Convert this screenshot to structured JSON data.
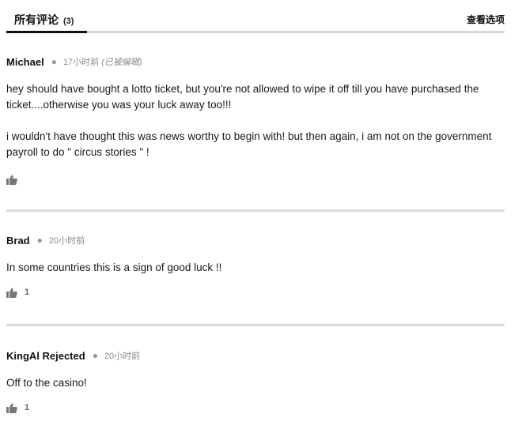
{
  "header": {
    "tab_title": "所有评论",
    "tab_count": "(3)",
    "view_options": "查看选项"
  },
  "comments": [
    {
      "author": "Michael",
      "time": "17小时前",
      "edited": "(已被编辑)",
      "paragraphs": [
        "hey should have bought a lotto ticket, but you're not allowed to wipe it off till you have purchased the ticket....otherwise you was your luck away too!!!",
        "i wouldn't have thought this was news worthy to begin with! but then again, i am not on the government payroll to do \" circus stories \" !"
      ],
      "likes": ""
    },
    {
      "author": "Brad",
      "time": "20小时前",
      "edited": "",
      "paragraphs": [
        "In some countries this is a sign of good luck !!"
      ],
      "likes": "1"
    },
    {
      "author": "KingAl Rejected",
      "time": "20小时前",
      "edited": "",
      "paragraphs": [
        "Off to the casino!"
      ],
      "likes": "1"
    }
  ],
  "icons": {
    "like": "thumbs-up-icon",
    "separator": "dot-separator"
  },
  "colors": {
    "text": "#222222",
    "muted": "#8a8a8a",
    "divider": "#dcdcdc",
    "active_tab": "#111111"
  }
}
